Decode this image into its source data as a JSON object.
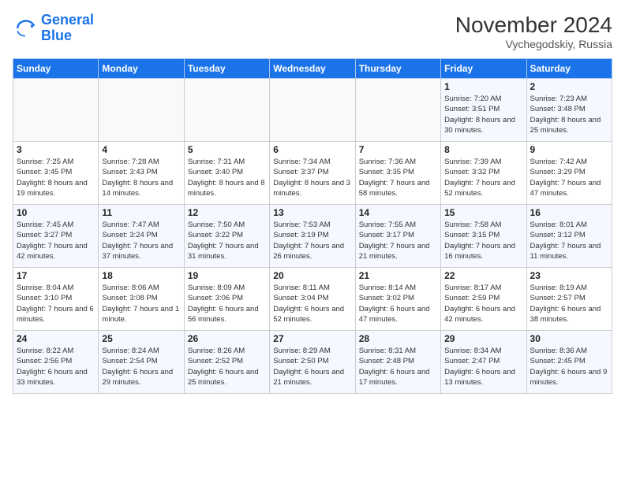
{
  "logo": {
    "line1": "General",
    "line2": "Blue"
  },
  "title": "November 2024",
  "subtitle": "Vychegodskiy, Russia",
  "days_of_week": [
    "Sunday",
    "Monday",
    "Tuesday",
    "Wednesday",
    "Thursday",
    "Friday",
    "Saturday"
  ],
  "weeks": [
    [
      {
        "day": "",
        "info": ""
      },
      {
        "day": "",
        "info": ""
      },
      {
        "day": "",
        "info": ""
      },
      {
        "day": "",
        "info": ""
      },
      {
        "day": "",
        "info": ""
      },
      {
        "day": "1",
        "info": "Sunrise: 7:20 AM\nSunset: 3:51 PM\nDaylight: 8 hours and 30 minutes."
      },
      {
        "day": "2",
        "info": "Sunrise: 7:23 AM\nSunset: 3:48 PM\nDaylight: 8 hours and 25 minutes."
      }
    ],
    [
      {
        "day": "3",
        "info": "Sunrise: 7:25 AM\nSunset: 3:45 PM\nDaylight: 8 hours and 19 minutes."
      },
      {
        "day": "4",
        "info": "Sunrise: 7:28 AM\nSunset: 3:43 PM\nDaylight: 8 hours and 14 minutes."
      },
      {
        "day": "5",
        "info": "Sunrise: 7:31 AM\nSunset: 3:40 PM\nDaylight: 8 hours and 8 minutes."
      },
      {
        "day": "6",
        "info": "Sunrise: 7:34 AM\nSunset: 3:37 PM\nDaylight: 8 hours and 3 minutes."
      },
      {
        "day": "7",
        "info": "Sunrise: 7:36 AM\nSunset: 3:35 PM\nDaylight: 7 hours and 58 minutes."
      },
      {
        "day": "8",
        "info": "Sunrise: 7:39 AM\nSunset: 3:32 PM\nDaylight: 7 hours and 52 minutes."
      },
      {
        "day": "9",
        "info": "Sunrise: 7:42 AM\nSunset: 3:29 PM\nDaylight: 7 hours and 47 minutes."
      }
    ],
    [
      {
        "day": "10",
        "info": "Sunrise: 7:45 AM\nSunset: 3:27 PM\nDaylight: 7 hours and 42 minutes."
      },
      {
        "day": "11",
        "info": "Sunrise: 7:47 AM\nSunset: 3:24 PM\nDaylight: 7 hours and 37 minutes."
      },
      {
        "day": "12",
        "info": "Sunrise: 7:50 AM\nSunset: 3:22 PM\nDaylight: 7 hours and 31 minutes."
      },
      {
        "day": "13",
        "info": "Sunrise: 7:53 AM\nSunset: 3:19 PM\nDaylight: 7 hours and 26 minutes."
      },
      {
        "day": "14",
        "info": "Sunrise: 7:55 AM\nSunset: 3:17 PM\nDaylight: 7 hours and 21 minutes."
      },
      {
        "day": "15",
        "info": "Sunrise: 7:58 AM\nSunset: 3:15 PM\nDaylight: 7 hours and 16 minutes."
      },
      {
        "day": "16",
        "info": "Sunrise: 8:01 AM\nSunset: 3:12 PM\nDaylight: 7 hours and 11 minutes."
      }
    ],
    [
      {
        "day": "17",
        "info": "Sunrise: 8:04 AM\nSunset: 3:10 PM\nDaylight: 7 hours and 6 minutes."
      },
      {
        "day": "18",
        "info": "Sunrise: 8:06 AM\nSunset: 3:08 PM\nDaylight: 7 hours and 1 minute."
      },
      {
        "day": "19",
        "info": "Sunrise: 8:09 AM\nSunset: 3:06 PM\nDaylight: 6 hours and 56 minutes."
      },
      {
        "day": "20",
        "info": "Sunrise: 8:11 AM\nSunset: 3:04 PM\nDaylight: 6 hours and 52 minutes."
      },
      {
        "day": "21",
        "info": "Sunrise: 8:14 AM\nSunset: 3:02 PM\nDaylight: 6 hours and 47 minutes."
      },
      {
        "day": "22",
        "info": "Sunrise: 8:17 AM\nSunset: 2:59 PM\nDaylight: 6 hours and 42 minutes."
      },
      {
        "day": "23",
        "info": "Sunrise: 8:19 AM\nSunset: 2:57 PM\nDaylight: 6 hours and 38 minutes."
      }
    ],
    [
      {
        "day": "24",
        "info": "Sunrise: 8:22 AM\nSunset: 2:56 PM\nDaylight: 6 hours and 33 minutes."
      },
      {
        "day": "25",
        "info": "Sunrise: 8:24 AM\nSunset: 2:54 PM\nDaylight: 6 hours and 29 minutes."
      },
      {
        "day": "26",
        "info": "Sunrise: 8:26 AM\nSunset: 2:52 PM\nDaylight: 6 hours and 25 minutes."
      },
      {
        "day": "27",
        "info": "Sunrise: 8:29 AM\nSunset: 2:50 PM\nDaylight: 6 hours and 21 minutes."
      },
      {
        "day": "28",
        "info": "Sunrise: 8:31 AM\nSunset: 2:48 PM\nDaylight: 6 hours and 17 minutes."
      },
      {
        "day": "29",
        "info": "Sunrise: 8:34 AM\nSunset: 2:47 PM\nDaylight: 6 hours and 13 minutes."
      },
      {
        "day": "30",
        "info": "Sunrise: 8:36 AM\nSunset: 2:45 PM\nDaylight: 6 hours and 9 minutes."
      }
    ]
  ]
}
